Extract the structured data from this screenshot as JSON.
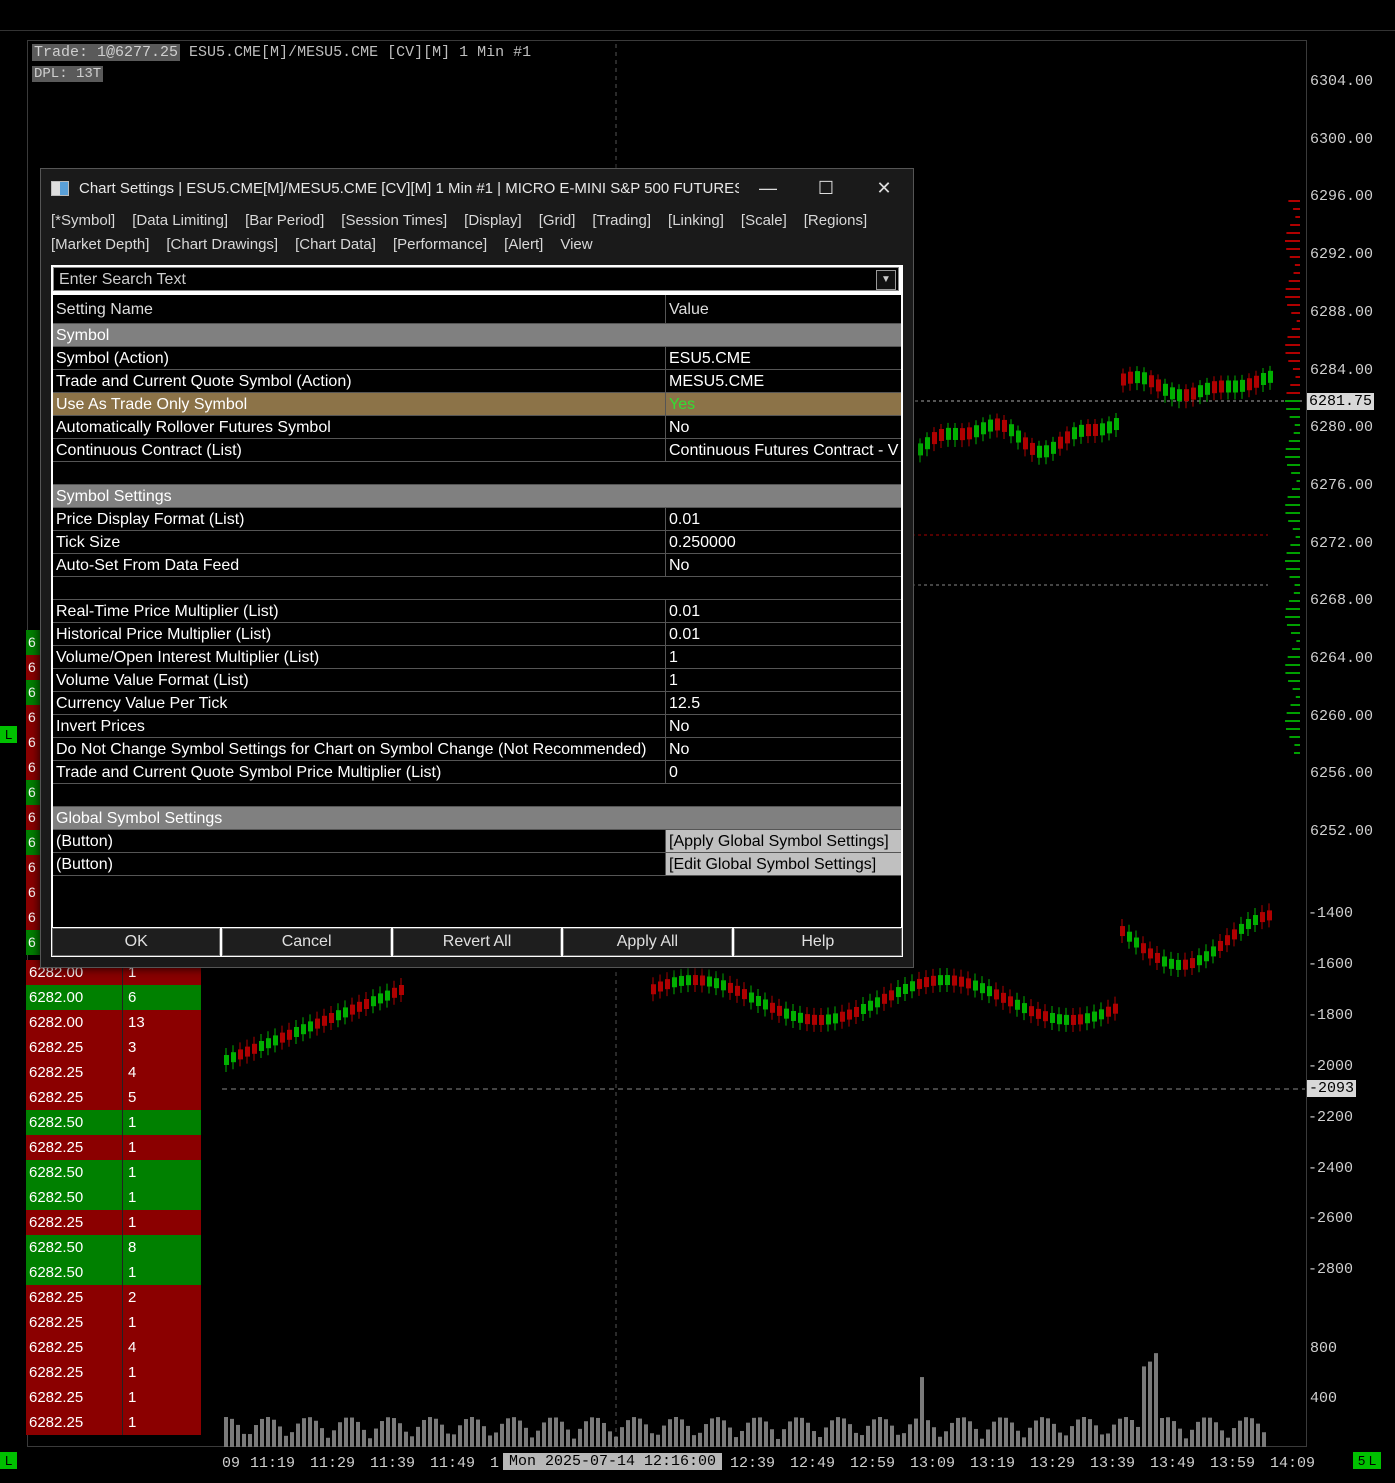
{
  "chart": {
    "trade_badge": "Trade: 1@6277.25",
    "symbol_line": "ESU5.CME[M]/MESU5.CME [CV][M] 1 Min #1",
    "dpl": "DPL: 13T",
    "price_axis": [
      "6304.00",
      "6300.00",
      "6296.00",
      "6292.00",
      "6288.00",
      "6284.00",
      "6280.00",
      "6276.00",
      "6272.00",
      "6268.00",
      "6264.00",
      "6260.00",
      "6256.00",
      "6252.00"
    ],
    "last_price": "6281.75",
    "study_axis": [
      "-1400",
      "-1600",
      "-1800",
      "-2000",
      "-2200",
      "-2400",
      "-2600",
      "-2800"
    ],
    "study_last": "-2093",
    "volume_axis": [
      "800",
      "400"
    ],
    "time_labels": [
      "09",
      "11:19",
      "11:29",
      "11:39",
      "11:49",
      "1",
      "12:39",
      "12:49",
      "12:59",
      "13:09",
      "13:19",
      "13:29",
      "13:39",
      "13:49",
      "13:59",
      "14:09"
    ],
    "cursor_time": "Mon 2025-07-14  12:16:00",
    "badge_bottom_left": "L",
    "badge_bottom_right": "5 L",
    "left_badge": "L"
  },
  "time_sales": {
    "strip": [
      "6",
      "6",
      "6",
      "6",
      "6",
      "6",
      "6",
      "6",
      "6",
      "6",
      "6",
      "6",
      "6"
    ],
    "rows": [
      {
        "p": "6282.00",
        "q": "1",
        "c": "red"
      },
      {
        "p": "6282.00",
        "q": "6",
        "c": "green"
      },
      {
        "p": "6282.00",
        "q": "13",
        "c": "red"
      },
      {
        "p": "6282.25",
        "q": "3",
        "c": "red"
      },
      {
        "p": "6282.25",
        "q": "4",
        "c": "red"
      },
      {
        "p": "6282.25",
        "q": "5",
        "c": "red"
      },
      {
        "p": "6282.50",
        "q": "1",
        "c": "green"
      },
      {
        "p": "6282.25",
        "q": "1",
        "c": "red"
      },
      {
        "p": "6282.50",
        "q": "1",
        "c": "green"
      },
      {
        "p": "6282.50",
        "q": "1",
        "c": "green"
      },
      {
        "p": "6282.25",
        "q": "1",
        "c": "red"
      },
      {
        "p": "6282.50",
        "q": "8",
        "c": "green"
      },
      {
        "p": "6282.50",
        "q": "1",
        "c": "green"
      },
      {
        "p": "6282.25",
        "q": "2",
        "c": "red"
      },
      {
        "p": "6282.25",
        "q": "1",
        "c": "red"
      },
      {
        "p": "6282.25",
        "q": "4",
        "c": "red"
      },
      {
        "p": "6282.25",
        "q": "1",
        "c": "red"
      },
      {
        "p": "6282.25",
        "q": "1",
        "c": "red"
      },
      {
        "p": "6282.25",
        "q": "1",
        "c": "red"
      }
    ]
  },
  "dialog": {
    "title": "Chart Settings | ESU5.CME[M]/MESU5.CME [CV][M]  1 Min  #1 | MICRO E-MINI S&P 500 FUTURES...",
    "min_icon": "—",
    "max_icon": "☐",
    "close_icon": "✕",
    "menu": [
      "[*Symbol]",
      "[Data Limiting]",
      "[Bar Period]",
      "[Session Times]",
      "[Display]",
      "[Grid]",
      "[Trading]",
      "[Linking]",
      "[Scale]",
      "[Regions]",
      "[Market Depth]",
      "[Chart Drawings]",
      "[Chart Data]",
      "[Performance]",
      "[Alert]",
      "View"
    ],
    "search_placeholder": "Enter Search Text",
    "header_name": "Setting Name",
    "header_value": "Value",
    "rows": [
      {
        "type": "section",
        "name": "Symbol"
      },
      {
        "type": "row",
        "name": "Symbol (Action)",
        "value": "ESU5.CME"
      },
      {
        "type": "row",
        "name": "Trade and Current Quote Symbol (Action)",
        "value": "MESU5.CME"
      },
      {
        "type": "selected",
        "name": "Use As Trade Only Symbol",
        "value": "Yes"
      },
      {
        "type": "row",
        "name": "Automatically Rollover Futures Symbol",
        "value": "No"
      },
      {
        "type": "row",
        "name": "Continuous Contract (List)",
        "value": "Continuous Futures Contract - V"
      },
      {
        "type": "blank"
      },
      {
        "type": "section",
        "name": "Symbol Settings"
      },
      {
        "type": "row",
        "name": "Price Display Format (List)",
        "value": "0.01"
      },
      {
        "type": "row",
        "name": "Tick Size",
        "value": "0.250000"
      },
      {
        "type": "row",
        "name": "Auto-Set From Data Feed",
        "value": "No"
      },
      {
        "type": "blank"
      },
      {
        "type": "row",
        "name": "Real-Time Price Multiplier (List)",
        "value": "0.01"
      },
      {
        "type": "row",
        "name": "Historical Price Multiplier (List)",
        "value": "0.01"
      },
      {
        "type": "row",
        "name": "Volume/Open Interest Multiplier (List)",
        "value": "1"
      },
      {
        "type": "row",
        "name": "Volume Value Format (List)",
        "value": "1"
      },
      {
        "type": "row",
        "name": "Currency Value Per Tick",
        "value": "12.5"
      },
      {
        "type": "row",
        "name": "Invert Prices",
        "value": "No"
      },
      {
        "type": "row",
        "name": "Do Not Change Symbol Settings for Chart on Symbol Change (Not Recommended)",
        "value": "No"
      },
      {
        "type": "row",
        "name": "Trade and Current Quote Symbol Price Multiplier (List)",
        "value": "0"
      },
      {
        "type": "blank"
      },
      {
        "type": "section",
        "name": "Global Symbol Settings"
      },
      {
        "type": "button",
        "name": " (Button)",
        "value": "[Apply Global Symbol Settings]"
      },
      {
        "type": "button",
        "name": " (Button)",
        "value": "[Edit Global Symbol Settings]"
      }
    ],
    "buttons": [
      "OK",
      "Cancel",
      "Revert All",
      "Apply All",
      "Help"
    ]
  },
  "colors": {
    "up": "#00c000",
    "down": "#c00000",
    "selected_row": "#8c7348",
    "yes": "#33dd33"
  }
}
